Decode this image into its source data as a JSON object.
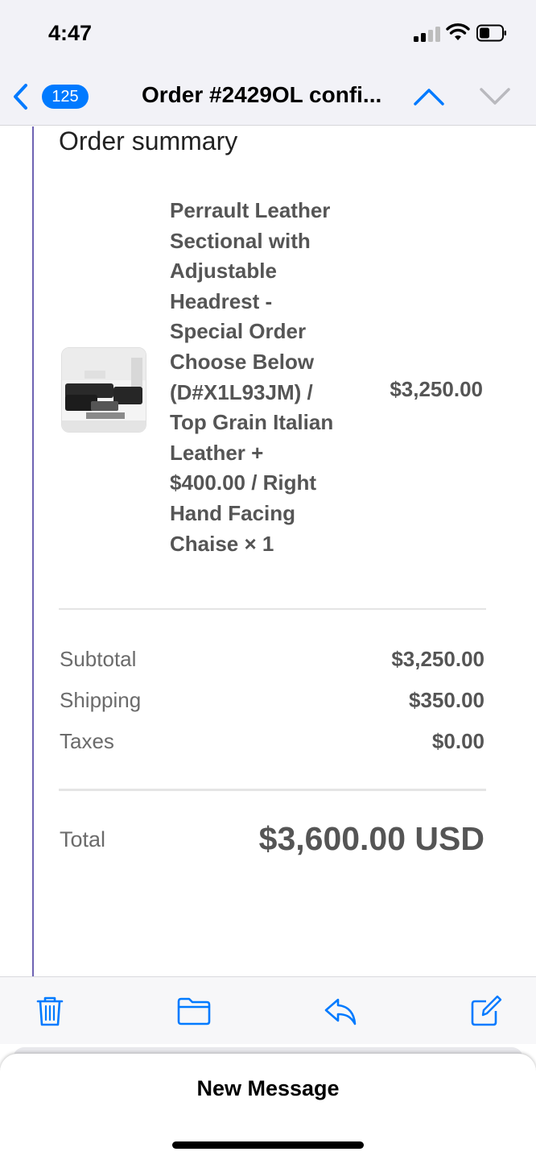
{
  "status_bar": {
    "time": "4:47"
  },
  "nav": {
    "unread_count": "125",
    "title": "Order #2429OL confi..."
  },
  "email": {
    "heading": "Order summary",
    "item": {
      "description_lines": [
        "Perrault Leather",
        "Sectional with",
        "Adjustable",
        "Headrest -",
        "Special Order",
        "Choose Below",
        "(D#X1L93JM) /",
        "Top Grain Italian",
        "Leather +",
        "$400.00 / Right",
        "Hand Facing",
        "Chaise × 1"
      ],
      "price": "$3,250.00"
    },
    "totals": [
      {
        "label": "Subtotal",
        "value": "$3,250.00"
      },
      {
        "label": "Shipping",
        "value": "$350.00"
      },
      {
        "label": "Taxes",
        "value": "$0.00"
      }
    ],
    "total": {
      "label": "Total",
      "value": "$3,600.00 USD"
    }
  },
  "toolbar": {
    "icons": [
      "trash-icon",
      "folder-icon",
      "reply-icon",
      "compose-icon"
    ]
  },
  "new_message": {
    "title": "New Message"
  },
  "colors": {
    "accent": "#007aff",
    "quote_line": "#6e63b3",
    "text_muted": "#6b6b6b",
    "text_strong": "#555555"
  }
}
